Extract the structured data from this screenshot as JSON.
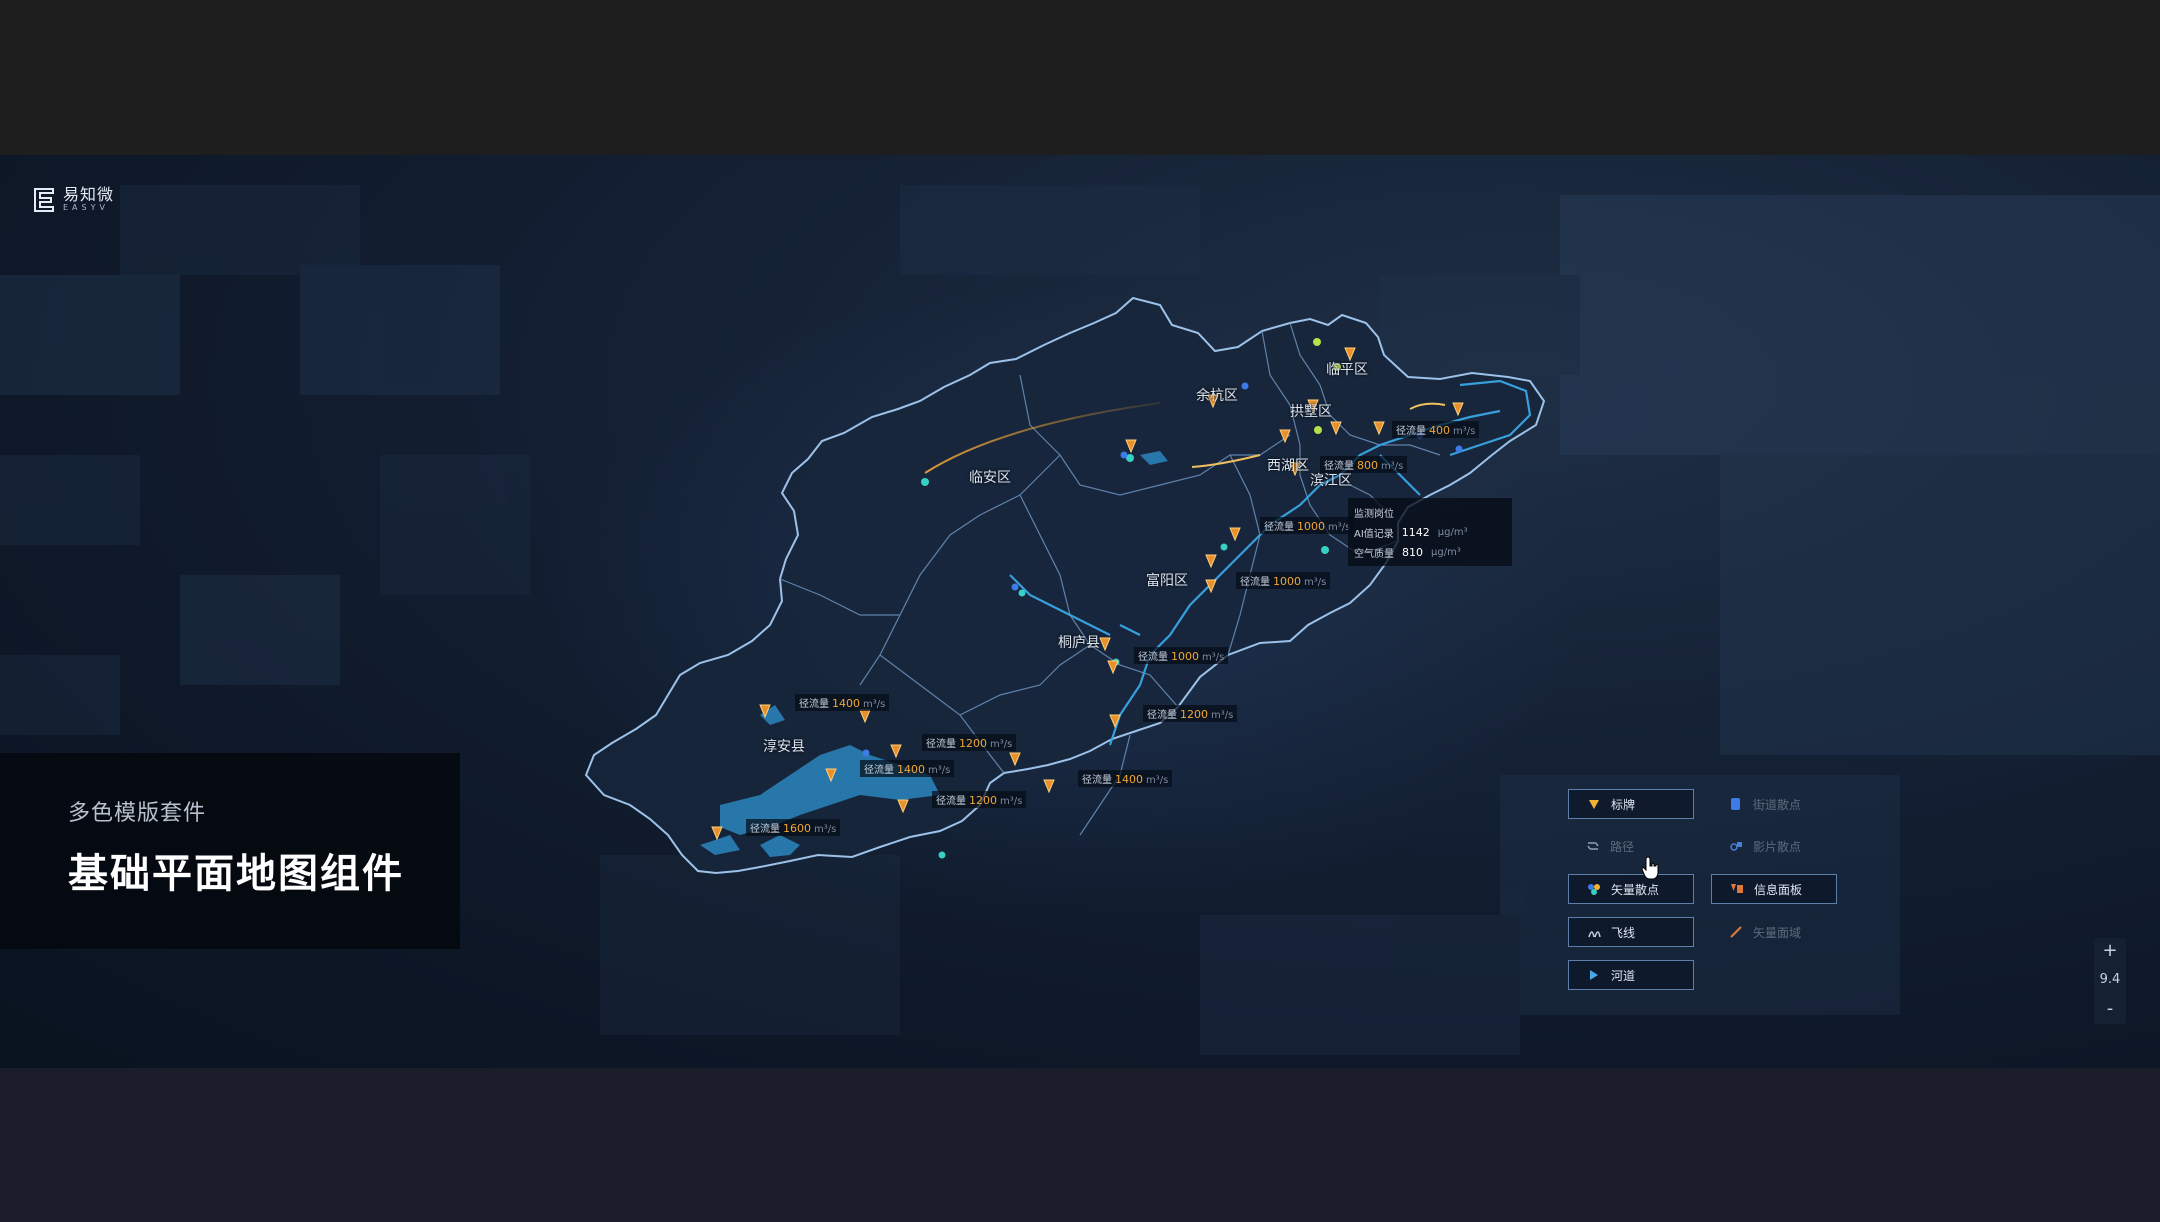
{
  "brand": {
    "name_cn": "易知微",
    "name_en": "EASYV"
  },
  "title_panel": {
    "subtitle": "多色模版套件",
    "title": "基础平面地图组件"
  },
  "map_labels": [
    {
      "id": "linan",
      "text": "临安区"
    },
    {
      "id": "yuhang",
      "text": "余杭区"
    },
    {
      "id": "linping",
      "text": "临平区"
    },
    {
      "id": "gongshu",
      "text": "拱墅区"
    },
    {
      "id": "xihu",
      "text": "西湖区"
    },
    {
      "id": "binjiang",
      "text": "滨江区"
    },
    {
      "id": "fuyang",
      "text": "富阳区"
    },
    {
      "id": "tonglu",
      "text": "桐庐县"
    },
    {
      "id": "chunan",
      "text": "淳安县"
    }
  ],
  "flow_labels": [
    {
      "id": "f1",
      "label": "径流量",
      "value": "400",
      "unit": "m³/s"
    },
    {
      "id": "f2",
      "label": "径流量",
      "value": "800",
      "unit": "m³/s"
    },
    {
      "id": "f3",
      "label": "径流量",
      "value": "1000",
      "unit": "m³/s"
    },
    {
      "id": "f4",
      "label": "径流量",
      "value": "1000",
      "unit": "m³/s"
    },
    {
      "id": "f5",
      "label": "径流量",
      "value": "1000",
      "unit": "m³/s"
    },
    {
      "id": "f6",
      "label": "径流量",
      "value": "1200",
      "unit": "m³/s"
    },
    {
      "id": "f7",
      "label": "径流量",
      "value": "1400",
      "unit": "m³/s"
    },
    {
      "id": "f8",
      "label": "径流量",
      "value": "1200",
      "unit": "m³/s"
    },
    {
      "id": "f9",
      "label": "径流量",
      "value": "1400",
      "unit": "m³/s"
    },
    {
      "id": "f10",
      "label": "径流量",
      "value": "1200",
      "unit": "m³/s"
    },
    {
      "id": "f11",
      "label": "径流量",
      "value": "1400",
      "unit": "m³/s"
    },
    {
      "id": "f12",
      "label": "径流量",
      "value": "1600",
      "unit": "m³/s"
    }
  ],
  "info_panel": {
    "title": "监测岗位",
    "rows": [
      {
        "label": "AI值记录",
        "value": "1142",
        "unit": "μg/m³"
      },
      {
        "label": "空气质量",
        "value": "810",
        "unit": "μg/m³"
      }
    ]
  },
  "legend": [
    {
      "id": "biaopai",
      "text": "标牌",
      "state": "on",
      "icon": "signboard-icon",
      "color": "#f2b233"
    },
    {
      "id": "jiedao",
      "text": "街道散点",
      "state": "off",
      "icon": "street-point-icon",
      "color": "#3c7be8"
    },
    {
      "id": "luxian",
      "text": "路径",
      "state": "off",
      "icon": "route-icon",
      "color": "#8fa0b6"
    },
    {
      "id": "tupian",
      "text": "影片散点",
      "state": "off",
      "icon": "image-point-icon",
      "color": "#4a7ed6"
    },
    {
      "id": "shiliang",
      "text": "矢量散点",
      "state": "on",
      "icon": "vector-point-icon",
      "color": "#36d1c4"
    },
    {
      "id": "xinxi",
      "text": "信息面板",
      "state": "on",
      "icon": "info-panel-icon",
      "color": "#e0783a"
    },
    {
      "id": "feixian",
      "text": "飞线",
      "state": "on",
      "icon": "flyline-icon",
      "color": "#c7d1df"
    },
    {
      "id": "mianqu",
      "text": "矢量面域",
      "state": "off",
      "icon": "vector-area-icon",
      "color": "#e0783a"
    },
    {
      "id": "hedao",
      "text": "河道",
      "state": "on",
      "icon": "river-icon",
      "color": "#4aa8e8"
    }
  ],
  "zoom": {
    "plus": "+",
    "level": "9.4",
    "minus": "-"
  },
  "colors": {
    "boundary": "#7fa7d2",
    "river": "#3aa6e6",
    "marker": "#e8902c",
    "flyline": "#f0a637",
    "accent_cyan": "#36d1c4"
  }
}
